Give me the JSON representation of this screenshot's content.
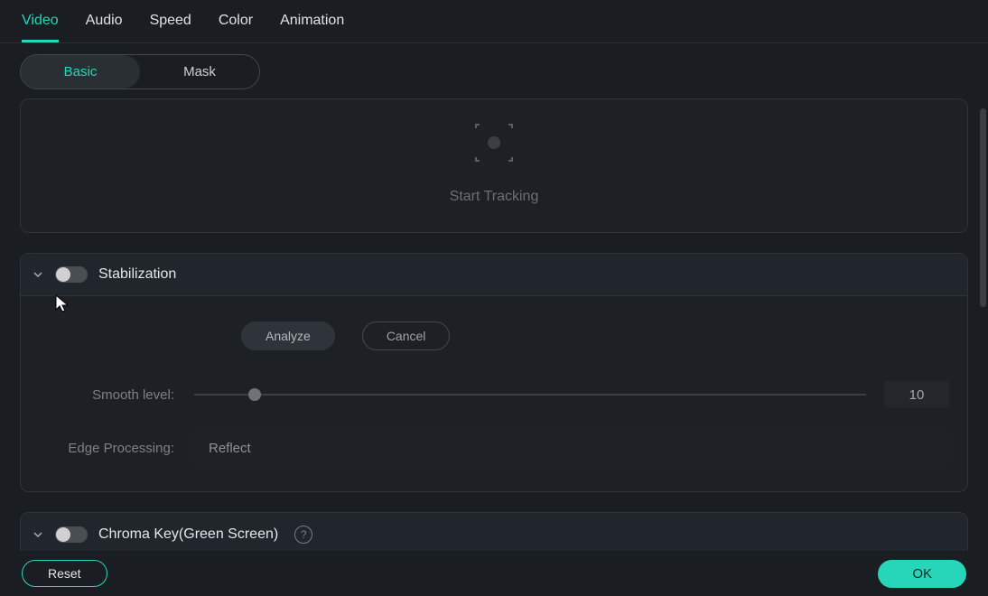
{
  "tabs": {
    "video": "Video",
    "audio": "Audio",
    "speed": "Speed",
    "color": "Color",
    "animation": "Animation"
  },
  "segmented": {
    "basic": "Basic",
    "mask": "Mask"
  },
  "tracking": {
    "start_label": "Start Tracking"
  },
  "stabilization": {
    "title": "Stabilization",
    "analyze_label": "Analyze",
    "cancel_label": "Cancel",
    "smooth_label": "Smooth level:",
    "smooth_value": "10",
    "edge_label": "Edge Processing:",
    "edge_value": "Reflect"
  },
  "chroma": {
    "title": "Chroma Key(Green Screen)"
  },
  "footer": {
    "reset": "Reset",
    "ok": "OK"
  }
}
